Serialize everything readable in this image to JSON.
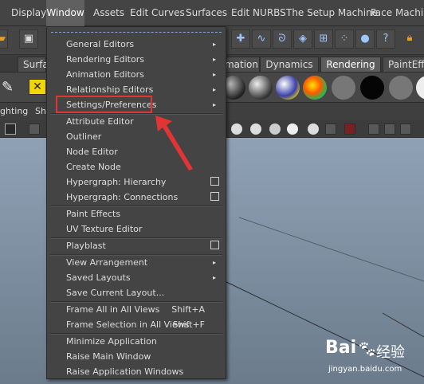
{
  "menubar": {
    "items": [
      "Display",
      "Window",
      "Assets",
      "Edit Curves",
      "Surfaces",
      "Edit NURBS",
      "The Setup Machine",
      "Face Machine"
    ]
  },
  "shelf": {
    "tabs": [
      "Surfac",
      "nimation",
      "Dynamics",
      "Rendering",
      "PaintEff"
    ]
  },
  "panel": {
    "menus": [
      "ghting",
      "Sho"
    ]
  },
  "window_menu": {
    "items": [
      {
        "label": "General Editors",
        "submenu": true
      },
      {
        "label": "Rendering Editors",
        "submenu": true
      },
      {
        "label": "Animation Editors",
        "submenu": true
      },
      {
        "label": "Relationship Editors",
        "submenu": true
      },
      {
        "label": "Settings/Preferences",
        "submenu": true
      },
      {
        "label": "Attribute Editor"
      },
      {
        "label": "Outliner"
      },
      {
        "label": "Node Editor"
      },
      {
        "label": "Create Node"
      },
      {
        "label": "Hypergraph: Hierarchy",
        "option_box": true
      },
      {
        "label": "Hypergraph: Connections",
        "option_box": true
      },
      {
        "label": "Paint Effects"
      },
      {
        "label": "UV Texture Editor"
      },
      {
        "label": "Playblast",
        "option_box": true
      },
      {
        "label": "View Arrangement",
        "submenu": true
      },
      {
        "label": "Saved Layouts",
        "submenu": true
      },
      {
        "label": "Save Current Layout..."
      },
      {
        "label": "Frame All in All Views",
        "shortcut": "Shift+A"
      },
      {
        "label": "Frame Selection in All Views",
        "shortcut": "Shift+F"
      },
      {
        "label": "Minimize Application"
      },
      {
        "label": "Raise Main Window"
      },
      {
        "label": "Raise Application Windows"
      }
    ]
  },
  "icons": {
    "toolbar": [
      "save-icon",
      "move-icon",
      "curve-icon",
      "plane-icon",
      "lattice-icon",
      "particles-icon",
      "sphere-icon",
      "help-icon",
      "lock-icon"
    ],
    "submenu_arrow": "▸"
  },
  "annotation": {
    "highlight_color": "#e23434",
    "arrow_color": "#e23434"
  },
  "watermark": {
    "brand": "Bai",
    "brand2": "经验",
    "url": "jingyan.baidu.com"
  }
}
